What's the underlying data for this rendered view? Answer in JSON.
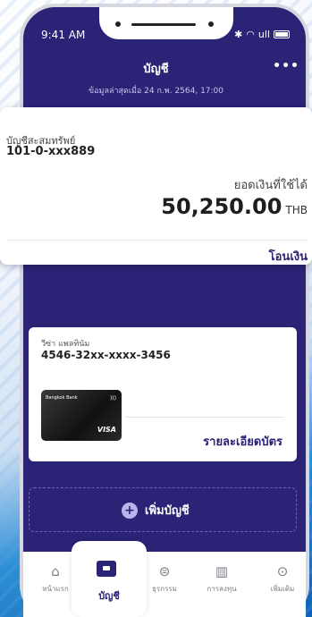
{
  "status": {
    "time": "9:41 AM",
    "signal": "ull"
  },
  "header": {
    "title": "บัญชี",
    "subtitle": "ข้อมูลล่าสุดเมื่อ 24 ก.พ. 2564, 17:00",
    "more": "•••"
  },
  "account": {
    "type": "บัญชีสะสมทรัพย์",
    "number": "101-0-xxx889",
    "available_label": "ยอดเงินที่ใช้ได้",
    "balance": "50,250.00",
    "currency": "THB",
    "transfer_label": "โอนเงิน"
  },
  "credit_card": {
    "type": "วีซ่า แพลทินัม",
    "number": "4546-32xx-xxxx-3456",
    "bank_name": "Bangkok Bank",
    "network": "VISA",
    "detail_label": "รายละเอียดบัตร"
  },
  "add_account": {
    "label": "เพิ่มบัญชี"
  },
  "tabs": [
    {
      "label": "หน้าแรก",
      "icon": "home-icon"
    },
    {
      "label": "บัญชี",
      "icon": "wallet-icon"
    },
    {
      "label": "ธุรกรรม",
      "icon": "transaction-icon"
    },
    {
      "label": "การลงทุน",
      "icon": "chart-icon"
    },
    {
      "label": "เพิ่มเติม",
      "icon": "more-icon"
    }
  ],
  "colors": {
    "primary": "#2b2376",
    "background": "#ffffff"
  }
}
